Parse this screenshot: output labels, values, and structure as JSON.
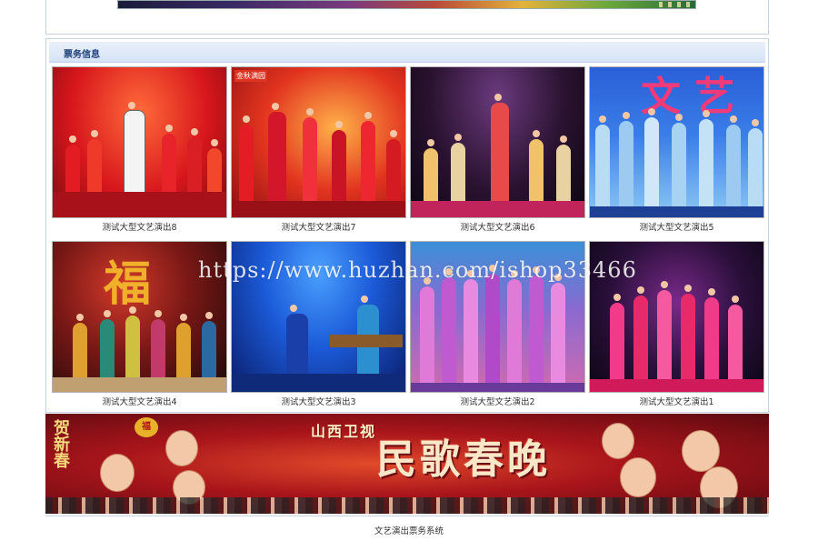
{
  "top_banner": {
    "marks": [
      "",
      "",
      "",
      ""
    ]
  },
  "section": {
    "title": "票务信息"
  },
  "shows": [
    {
      "name": "测试大型文艺演出8",
      "theme": "red-stage-singer"
    },
    {
      "name": "测试大型文艺演出7",
      "theme": "children-red",
      "tag": "金秋满园"
    },
    {
      "name": "测试大型文艺演出6",
      "theme": "dark-stage-dancers"
    },
    {
      "name": "测试大型文艺演出5",
      "theme": "blue-ethnic-dance",
      "big_text": "文  艺"
    },
    {
      "name": "测试大型文艺演出4",
      "theme": "chinese-knot-stage",
      "big_text": "福"
    },
    {
      "name": "测试大型文艺演出3",
      "theme": "blue-music-performance"
    },
    {
      "name": "测试大型文艺演出2",
      "theme": "purple-group-dance"
    },
    {
      "name": "测试大型文艺演出1",
      "theme": "pink-group-dance"
    }
  ],
  "watermark": "https://www.huzhan.com/ishop33466",
  "bottom_banner": {
    "title": "民歌春晚",
    "subtitle": "山西卫视",
    "left_text": "贺新春",
    "badge": "福"
  },
  "footer": {
    "text": "文艺演出票务系统"
  },
  "colors": {
    "panel_border": "#c7d3e3",
    "panel_head": "#d6e3f6",
    "title_text": "#1e3f78",
    "banner_red": "#a9151b"
  }
}
